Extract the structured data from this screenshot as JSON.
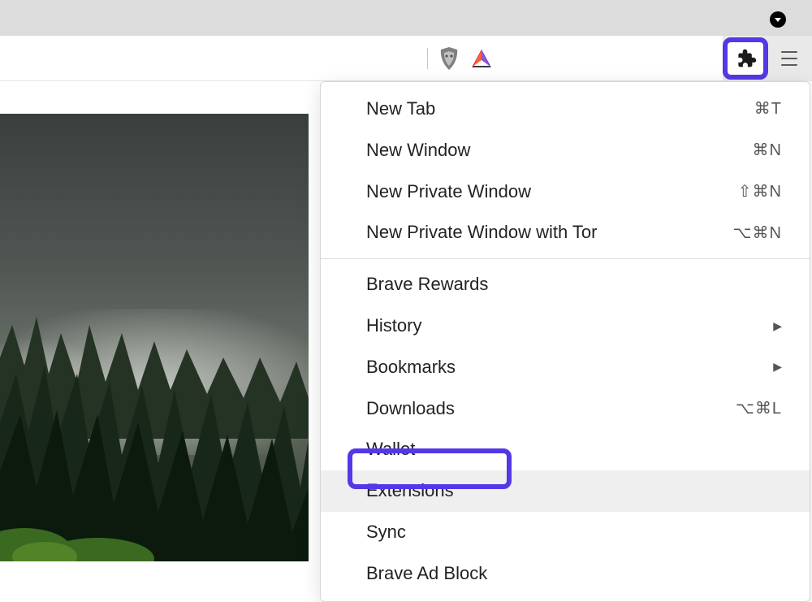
{
  "menu": {
    "items": [
      {
        "label": "New Tab",
        "shortcut": "⌘T",
        "submenu": false
      },
      {
        "label": "New Window",
        "shortcut": "⌘N",
        "submenu": false
      },
      {
        "label": "New Private Window",
        "shortcut": "⇧⌘N",
        "submenu": false
      },
      {
        "label": "New Private Window with Tor",
        "shortcut": "⌥⌘N",
        "submenu": false
      }
    ],
    "items2": [
      {
        "label": "Brave Rewards",
        "shortcut": "",
        "submenu": false
      },
      {
        "label": "History",
        "shortcut": "",
        "submenu": true
      },
      {
        "label": "Bookmarks",
        "shortcut": "",
        "submenu": true
      },
      {
        "label": "Downloads",
        "shortcut": "⌥⌘L",
        "submenu": false
      },
      {
        "label": "Wallet",
        "shortcut": "",
        "submenu": false
      },
      {
        "label": "Extensions",
        "shortcut": "",
        "submenu": false,
        "hover": true,
        "highlight": true
      },
      {
        "label": "Sync",
        "shortcut": "",
        "submenu": false
      },
      {
        "label": "Brave Ad Block",
        "shortcut": "",
        "submenu": false
      }
    ]
  },
  "highlight_color": "#5338e6"
}
